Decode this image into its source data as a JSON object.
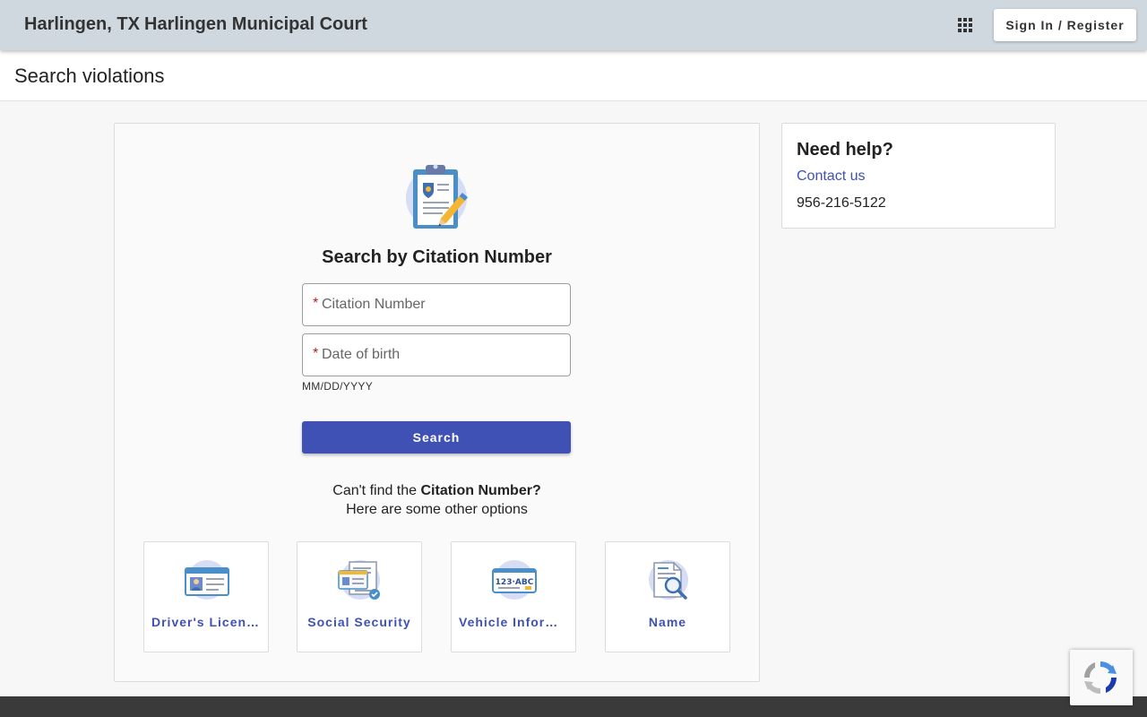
{
  "header": {
    "city": "Harlingen, TX",
    "court": "Harlingen Municipal Court",
    "apps_icon": "apps-grid-icon",
    "signin_label": "Sign In / Register"
  },
  "page": {
    "title": "Search violations"
  },
  "search": {
    "heading": "Search by Citation Number",
    "hero_icon": "clipboard-pencil-icon",
    "required_mark": "*",
    "citation_placeholder": "Citation Number",
    "dob_placeholder": "Date of birth",
    "dob_hint": "MM/DD/YYYY",
    "button_label": "Search",
    "alt_prefix": "Can't find the ",
    "alt_emphasis": "Citation Number?",
    "alt_line2": "Here are some other options",
    "options": [
      {
        "label": "Driver's License",
        "icon": "drivers-license-icon"
      },
      {
        "label": "Social Security",
        "icon": "social-security-card-icon"
      },
      {
        "label": "Vehicle Information",
        "icon": "license-plate-icon"
      },
      {
        "label": "Name",
        "icon": "document-magnifier-icon"
      }
    ]
  },
  "help": {
    "title": "Need help?",
    "contact_label": "Contact us",
    "phone": "956-216-5122"
  },
  "recaptcha": {
    "icon": "recaptcha-icon"
  },
  "colors": {
    "header_bg": "#cfd8df",
    "accent": "#3f51b5",
    "required": "#b01e23",
    "footer_bg": "#3a3a3a"
  }
}
